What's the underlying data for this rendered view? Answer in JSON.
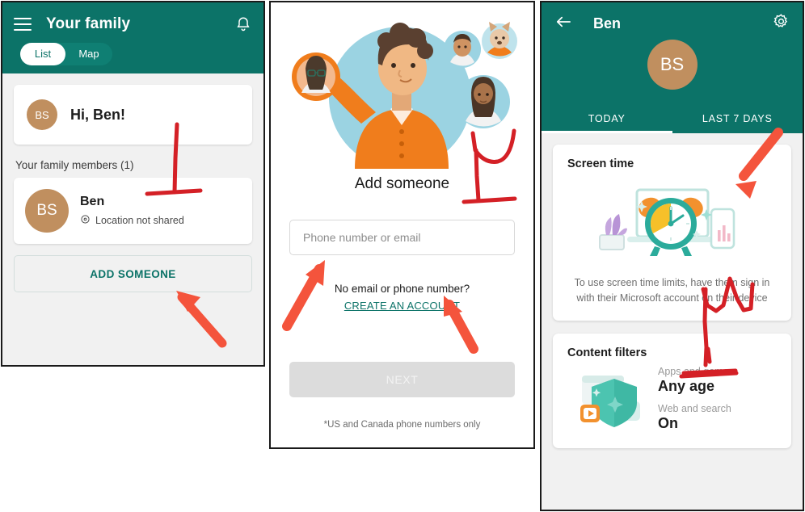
{
  "panel_family": {
    "header": {
      "menu_icon": "hamburger-icon",
      "title": "Your family",
      "bell_icon": "notification-bell-icon",
      "tabs": [
        {
          "label": "List",
          "active": true
        },
        {
          "label": "Map",
          "active": false
        }
      ]
    },
    "greeting": {
      "avatar_initials": "BS",
      "text": "Hi, Ben!"
    },
    "members_label": "Your family members (1)",
    "members": [
      {
        "avatar_initials": "BS",
        "name": "Ben",
        "status_icon": "location-pin-icon",
        "status": "Location not shared"
      }
    ],
    "add_button": "ADD SOMEONE"
  },
  "panel_add": {
    "illustration": "family-avatars-illustration",
    "title": "Add someone",
    "input": {
      "value": "",
      "placeholder": "Phone number or email"
    },
    "no_email_text": "No email or phone number?",
    "create_account_link": "CREATE AN ACCOUNT",
    "next_button": "NEXT",
    "disclaimer": "*US and Canada phone numbers only"
  },
  "panel_detail": {
    "header": {
      "back_icon": "back-arrow-icon",
      "title": "Ben",
      "settings_icon": "gear-icon",
      "avatar_initials": "BS",
      "tabs": [
        {
          "label": "TODAY",
          "active": true
        },
        {
          "label": "LAST 7 DAYS",
          "active": false
        }
      ]
    },
    "screen_time": {
      "title": "Screen time",
      "illustration": "alarm-clock-laptop-illustration",
      "description": "To use screen time limits, have them sign in with their Microsoft account on their device"
    },
    "content_filters": {
      "title": "Content filters",
      "illustration": "shield-media-icon",
      "rows": [
        {
          "label": "Apps and games",
          "value": "Any age"
        },
        {
          "label": "Web and search",
          "value": "On"
        }
      ]
    }
  },
  "colors": {
    "brand_green": "#0c7368",
    "annotation_red": "#d42026",
    "arrow_red": "#f4543c",
    "avatar_brown": "#c08f5f",
    "panel_bg": "#f1f1f1"
  },
  "annotations": {
    "marks": [
      {
        "name": "t-mark-family-members",
        "type": "t-shape"
      },
      {
        "name": "arrow-add-someone",
        "type": "arrow"
      },
      {
        "name": "u-mark-add-someone-title",
        "type": "u-shape"
      },
      {
        "name": "arrow-phone-input",
        "type": "arrow"
      },
      {
        "name": "arrow-create-account",
        "type": "arrow"
      },
      {
        "name": "arrow-screen-time-card",
        "type": "arrow"
      },
      {
        "name": "w-mark-screen-time-text",
        "type": "w-shape"
      },
      {
        "name": "line-content-filters",
        "type": "line"
      }
    ]
  }
}
